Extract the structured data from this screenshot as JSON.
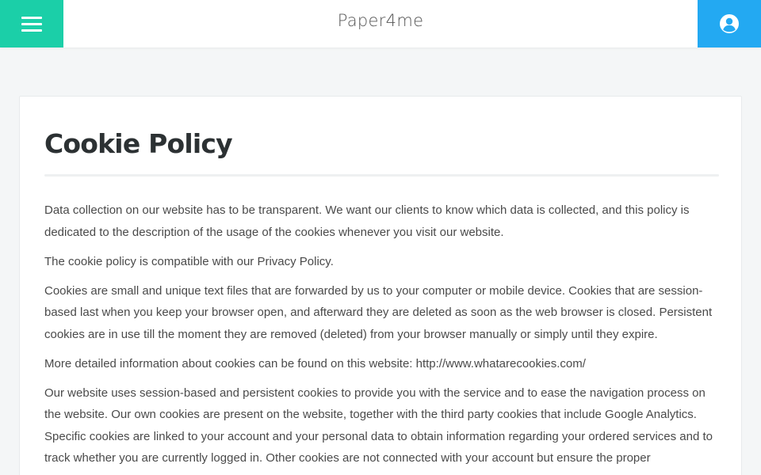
{
  "header": {
    "logo": "Paper4me",
    "menu_icon": "hamburger-menu-icon",
    "user_icon": "user-account-icon"
  },
  "colors": {
    "menu_button": "#1bcfa8",
    "user_button": "#23a9f2",
    "title": "#2c3133",
    "text": "#4a4a4a"
  },
  "page": {
    "title": "Cookie Policy",
    "paragraphs": [
      "Data collection on our website has to be transparent. We want our clients to know which data is collected, and this policy is dedicated to the description of the usage of the cookies whenever you visit our website.",
      "The cookie policy is compatible with our Privacy Policy.",
      "Cookies are small and unique text files that are forwarded by us to your computer or mobile device. Cookies that are session-based last when you keep your browser open, and afterward they are deleted as soon as the web browser is closed. Persistent cookies are in use till the moment they are removed (deleted) from your browser manually or simply until they expire.",
      "More detailed information about cookies can be found on this website: http://www.whatarecookies.com/",
      "Our website uses session-based and persistent cookies to provide you with the service and to ease the navigation process on the website. Our own cookies are present on the website, together with the third party cookies that include Google Analytics. Specific cookies are linked to your account and your personal data to obtain information regarding your ordered services and to track whether you are currently logged in. Other cookies are not connected with your account but ensure the proper"
    ]
  }
}
